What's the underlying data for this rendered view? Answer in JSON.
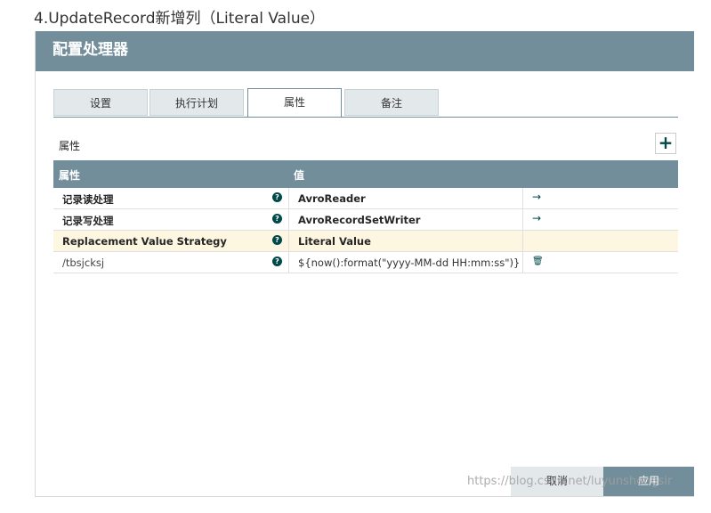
{
  "page": {
    "heading": "4.UpdateRecord新增列（Literal Value）"
  },
  "dialog": {
    "title": "配置处理器",
    "tabs": [
      {
        "label": "设置"
      },
      {
        "label": "执行计划"
      },
      {
        "label": "属性"
      },
      {
        "label": "备注"
      }
    ],
    "active_tab": "属性",
    "section_label": "属性",
    "add_symbol": "+",
    "grid": {
      "headers": {
        "property": "属性",
        "value": "值"
      },
      "rows": [
        {
          "name": "记录读处理",
          "help": "?",
          "value": "AvroReader",
          "action": "→"
        },
        {
          "name": "记录写处理",
          "help": "?",
          "value": "AvroRecordSetWriter",
          "action": "→"
        },
        {
          "name": "Replacement Value Strategy",
          "help": "?",
          "value": "Literal Value",
          "action": ""
        },
        {
          "name": "/tbsjcksj",
          "help": "?",
          "value": "${now():format(\"yyyy-MM-dd HH:mm:ss\")}",
          "action": "🗑"
        }
      ]
    },
    "buttons": {
      "cancel": "取消",
      "apply": "应用"
    }
  },
  "watermark": "https://blog.csdn.net/luyunshengsir",
  "colors": {
    "header": "#728e9b",
    "tab_inactive": "#e3e8eb",
    "highlight_row": "#fdf7e1",
    "icon": "#004849"
  }
}
